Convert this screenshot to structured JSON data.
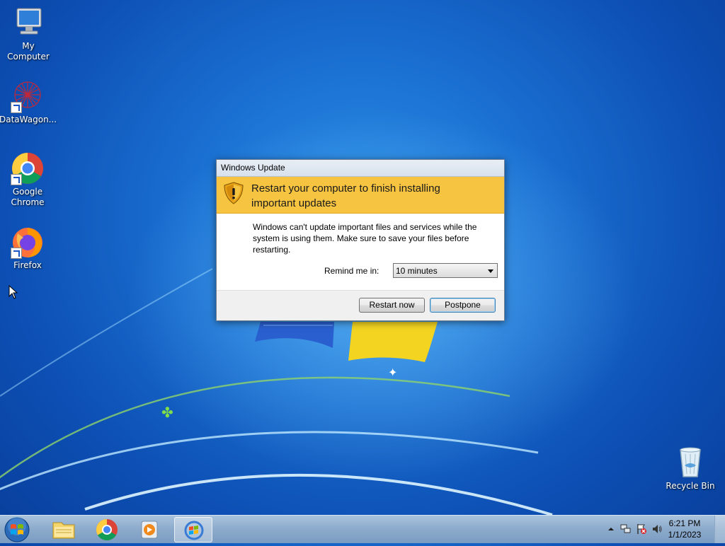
{
  "desktop": {
    "icons": [
      {
        "label": "My Computer",
        "icon": "computer-icon"
      },
      {
        "label": "DataWagon...",
        "icon": "datawagon-icon"
      },
      {
        "label": "Google\nChrome",
        "label_line1": "Google",
        "label_line2": "Chrome",
        "icon": "chrome-icon"
      },
      {
        "label": "Firefox",
        "icon": "firefox-icon"
      },
      {
        "label": "Recycle Bin",
        "icon": "recycle-bin-icon"
      }
    ]
  },
  "dialog": {
    "title": "Windows Update",
    "heading_line1": "Restart your computer to finish installing",
    "heading_line2": "important updates",
    "body": "Windows can't update important files and services while the system is using them. Make sure to save your files before restarting.",
    "remind_label": "Remind me in:",
    "remind_value": "10 minutes",
    "restart_label": "Restart now",
    "postpone_label": "Postpone"
  },
  "taskbar": {
    "pinned": [
      {
        "name": "windows-explorer",
        "icon": "folder-icon"
      },
      {
        "name": "google-chrome",
        "icon": "chrome-icon"
      },
      {
        "name": "media-player",
        "icon": "media-player-icon"
      },
      {
        "name": "windows-update",
        "icon": "windows-update-icon",
        "active": true
      }
    ],
    "clock_time": "6:21 PM",
    "clock_date": "1/1/2023"
  },
  "colors": {
    "banner": "#f6c440",
    "desktop": "#1a6fd1"
  }
}
